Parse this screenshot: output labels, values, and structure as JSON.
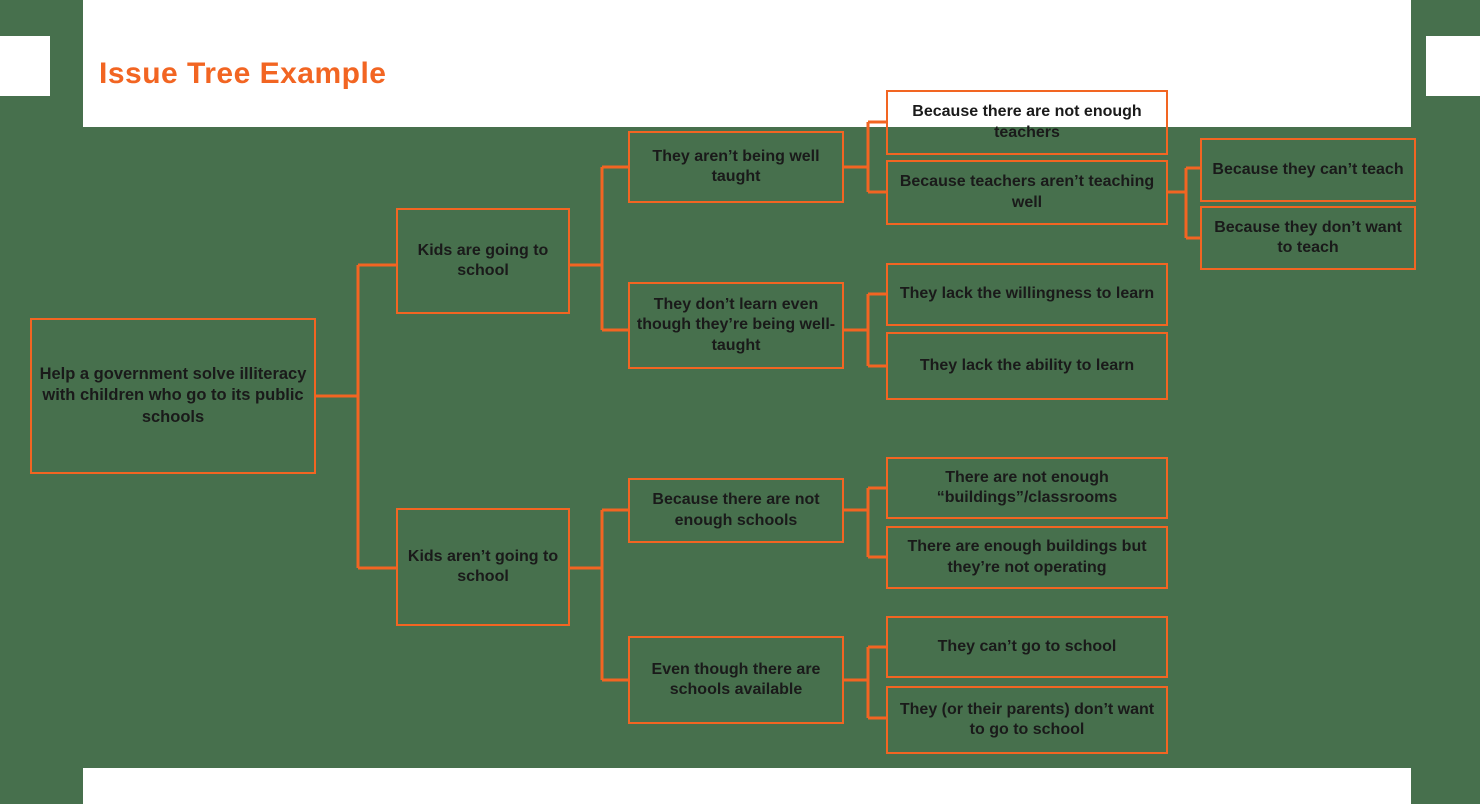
{
  "page": {
    "title": "Issue Tree Example",
    "accent_color": "#F26522",
    "background_color": "#47704d",
    "panel_color": "#ffffff",
    "text_color": "#1a1a1a"
  },
  "tree": {
    "root": {
      "id": "root",
      "label": "Help a government solve illiteracy with children who go to its public schools"
    },
    "level2": [
      {
        "id": "kids-going",
        "label": "Kids are going to school"
      },
      {
        "id": "kids-not-going",
        "label": "Kids aren’t going to school"
      }
    ],
    "level3": [
      {
        "id": "not-well-taught",
        "label": "They aren’t being well taught"
      },
      {
        "id": "dont-learn",
        "label": "They don’t learn even though they’re being well-taught"
      },
      {
        "id": "not-enough-schools",
        "label": "Because there are not enough schools"
      },
      {
        "id": "schools-available",
        "label": "Even though there are schools available"
      }
    ],
    "level4": [
      {
        "id": "not-enough-teachers",
        "label": "Because there are not enough teachers"
      },
      {
        "id": "teachers-not-teaching",
        "label": "Because teachers aren’t teaching well"
      },
      {
        "id": "lack-willingness",
        "label": "They lack the willingness to learn"
      },
      {
        "id": "lack-ability",
        "label": "They lack the ability to learn"
      },
      {
        "id": "not-enough-buildings",
        "label": "There are not enough “buildings”/classrooms"
      },
      {
        "id": "buildings-not-operating",
        "label": "There are enough buildings but they’re not operating"
      },
      {
        "id": "cant-go-to-school",
        "label": "They can’t go to school"
      },
      {
        "id": "dont-want-to-go",
        "label": "They (or their parents) don’t want to go to school"
      }
    ],
    "level5": [
      {
        "id": "cant-teach",
        "label": "Because they can’t teach"
      },
      {
        "id": "dont-want-teach",
        "label": "Because they don’t want to teach"
      }
    ]
  },
  "chart_data": {
    "type": "diagram",
    "title": "Issue Tree Example",
    "structure": "hierarchical-issue-tree",
    "levels": 5,
    "nodes": [
      {
        "level": 1,
        "label": "Help a government solve illiteracy with children who go to its public schools",
        "parent": null
      },
      {
        "level": 2,
        "label": "Kids are going to school",
        "parent": "Help a government solve illiteracy with children who go to its public schools"
      },
      {
        "level": 2,
        "label": "Kids aren’t going to school",
        "parent": "Help a government solve illiteracy with children who go to its public schools"
      },
      {
        "level": 3,
        "label": "They aren’t being well taught",
        "parent": "Kids are going to school"
      },
      {
        "level": 3,
        "label": "They don’t learn even though they’re being well-taught",
        "parent": "Kids are going to school"
      },
      {
        "level": 3,
        "label": "Because there are not enough schools",
        "parent": "Kids aren’t going to school"
      },
      {
        "level": 3,
        "label": "Even though there are schools available",
        "parent": "Kids aren’t going to school"
      },
      {
        "level": 4,
        "label": "Because there are not enough teachers",
        "parent": "They aren’t being well taught"
      },
      {
        "level": 4,
        "label": "Because teachers aren’t teaching well",
        "parent": "They aren’t being well taught"
      },
      {
        "level": 4,
        "label": "They lack the willingness to learn",
        "parent": "They don’t learn even though they’re being well-taught"
      },
      {
        "level": 4,
        "label": "They lack the ability to learn",
        "parent": "They don’t learn even though they’re being well-taught"
      },
      {
        "level": 4,
        "label": "There are not enough “buildings”/classrooms",
        "parent": "Because there are not enough schools"
      },
      {
        "level": 4,
        "label": "There are enough buildings but they’re not operating",
        "parent": "Because there are not enough schools"
      },
      {
        "level": 4,
        "label": "They can’t go to school",
        "parent": "Even though there are schools available"
      },
      {
        "level": 4,
        "label": "They (or their parents) don’t want to go to school",
        "parent": "Even though there are schools available"
      },
      {
        "level": 5,
        "label": "Because they can’t teach",
        "parent": "Because teachers aren’t teaching well"
      },
      {
        "level": 5,
        "label": "Because they don’t want to teach",
        "parent": "Because teachers aren’t teaching well"
      }
    ]
  }
}
